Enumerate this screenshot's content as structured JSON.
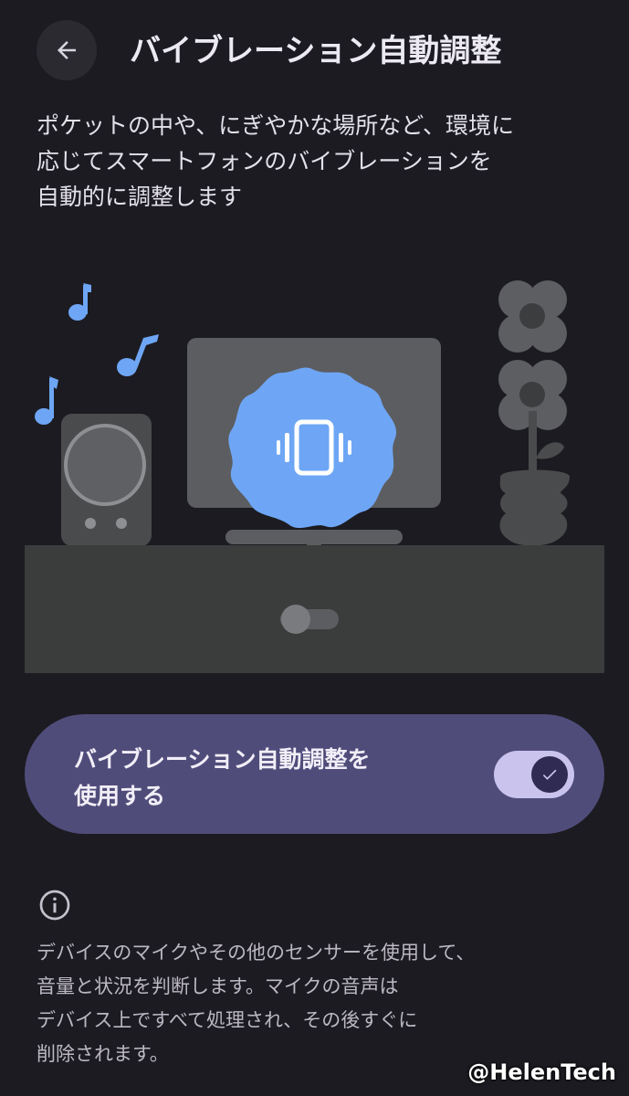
{
  "header": {
    "back_icon": "arrow-back-icon",
    "title": "バイブレーション自動調整"
  },
  "description": {
    "line1": "ポケットの中や、にぎやかな場所など、環境に",
    "line2": "応じてスマートフォンのバイブレーションを",
    "line3": "自動的に調整します"
  },
  "illustration": {
    "elements": [
      "music-note-icon",
      "speaker",
      "monitor",
      "vibration-badge-icon",
      "flower-plant",
      "cabinet"
    ],
    "accent_color": "#6ea6f5"
  },
  "toggle": {
    "line1": "バイブレーション自動調整を",
    "line2": "使用する",
    "state": "on",
    "check_icon": "check-icon"
  },
  "info": {
    "icon": "info-icon",
    "line1": "デバイスのマイクやその他のセンサーを使用して、",
    "line2": "音量と状況を判断します。マイクの音声は",
    "line3": "デバイス上ですべて処理され、その後すぐに",
    "line4": "削除されます。"
  },
  "watermark": "@HelenTech",
  "colors": {
    "background": "#1c1b21",
    "card": "#504c7a",
    "switch_track": "#c9c3ee",
    "switch_thumb": "#2f2b52"
  }
}
